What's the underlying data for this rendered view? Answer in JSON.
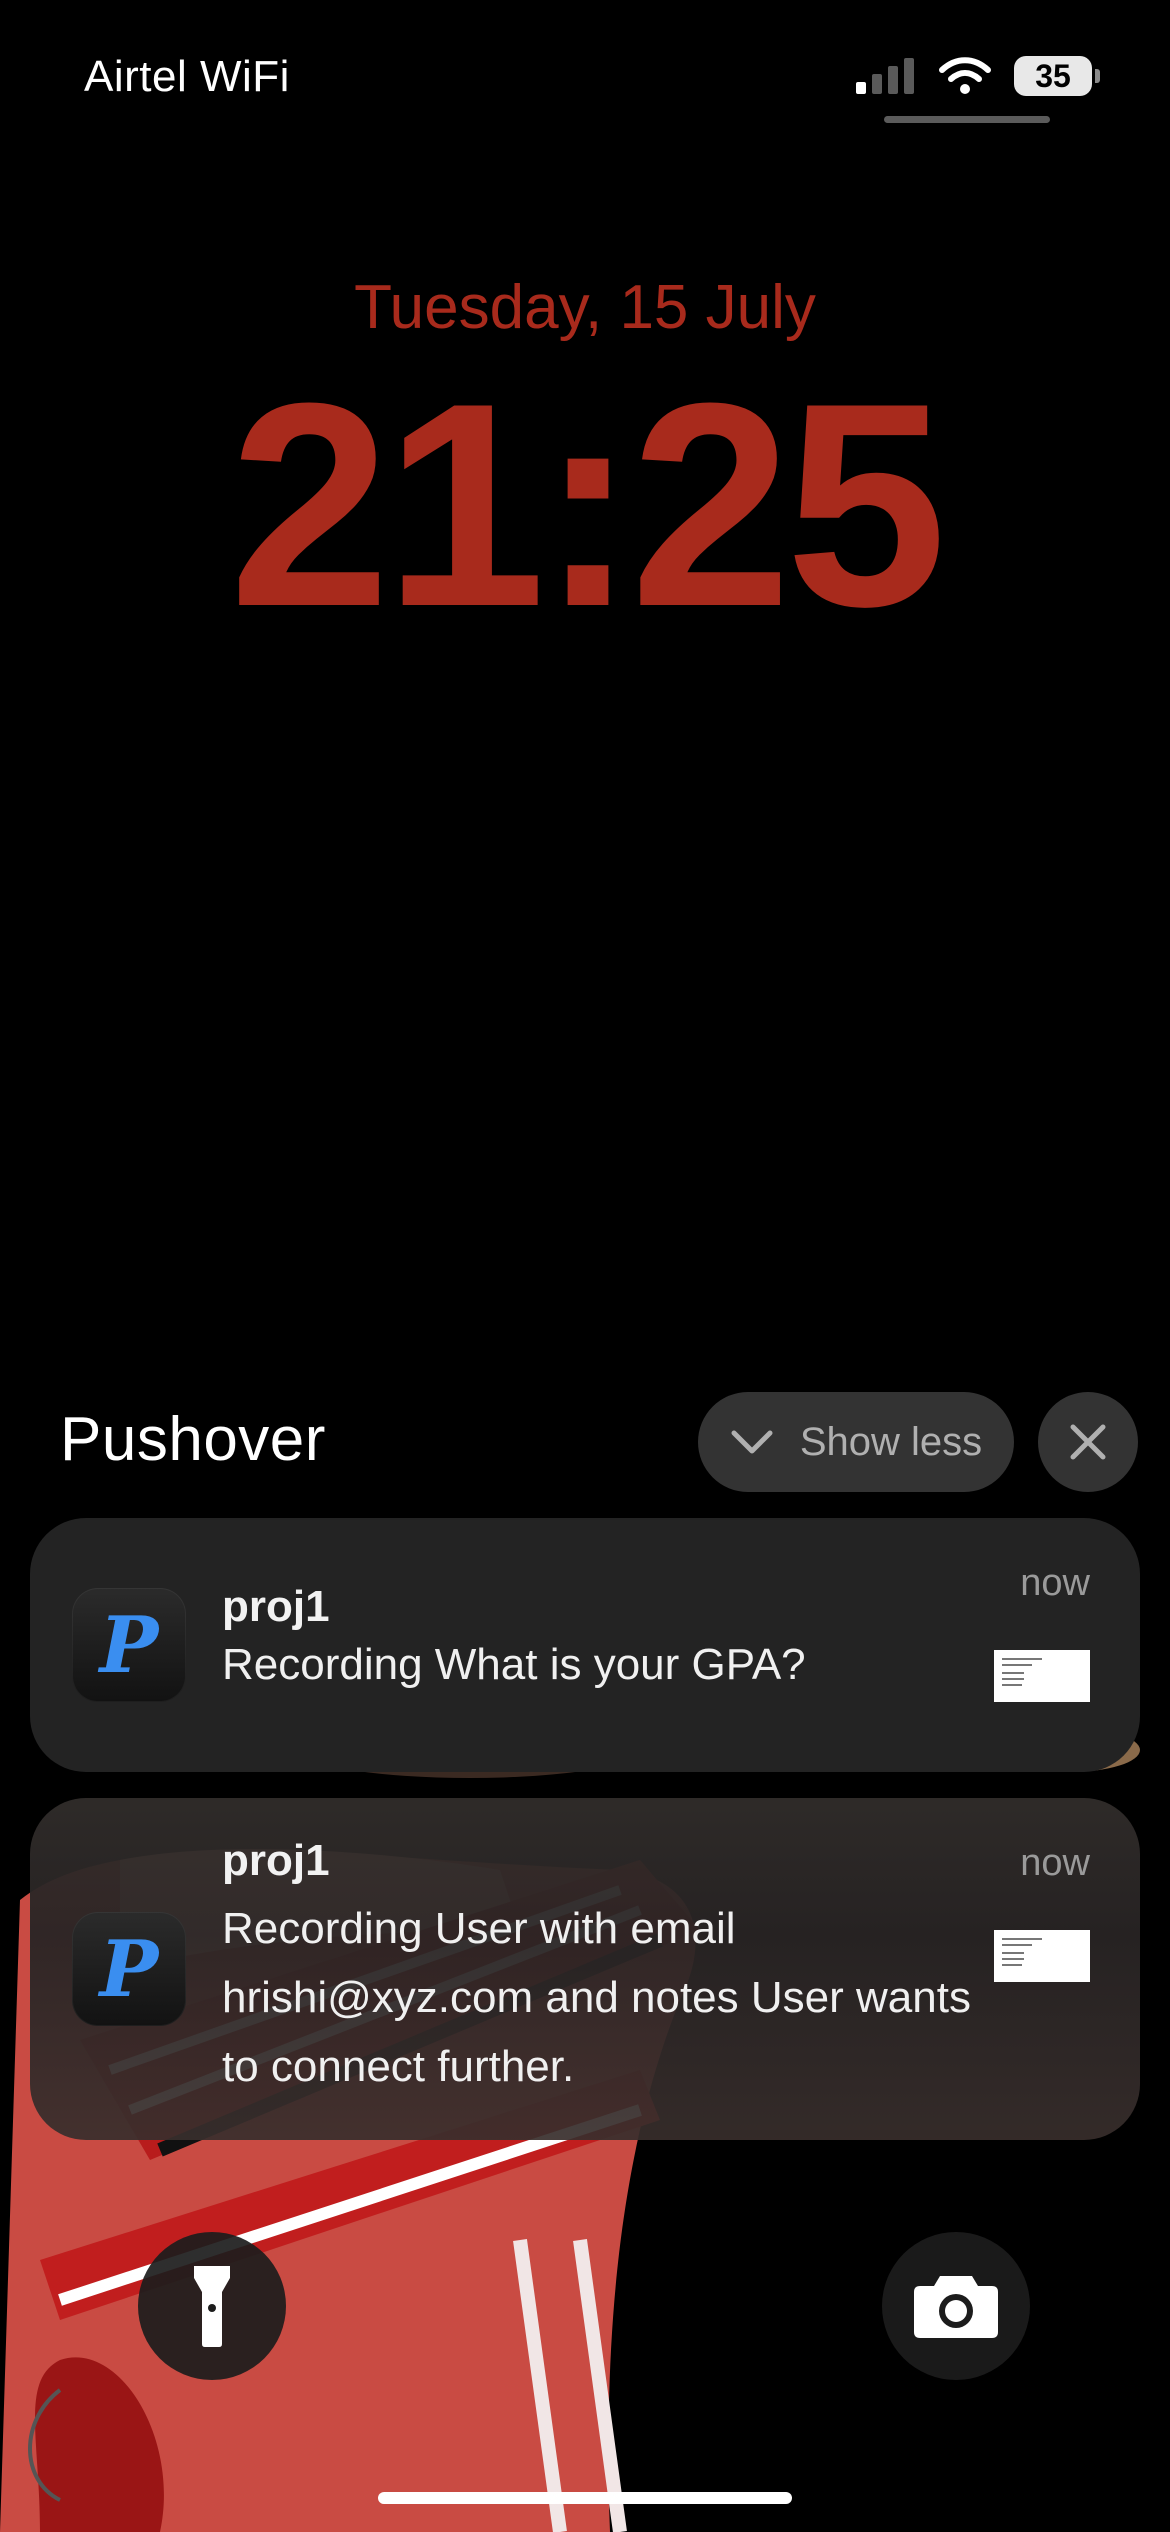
{
  "status_bar": {
    "carrier": "Airtel WiFi",
    "battery_level": "35",
    "signal_icon": "cellular-signal-icon",
    "wifi_icon": "wifi-icon"
  },
  "lock_screen": {
    "date": "Tuesday, 15 July",
    "time": "21:25",
    "accent_color": "#a82a1c"
  },
  "notification_group": {
    "app_name": "Pushover",
    "show_less_label": "Show less",
    "close_icon": "close-icon",
    "notifications": [
      {
        "title": "proj1",
        "body": "Recording What is your GPA?",
        "time": "now",
        "app_icon_letter": "P"
      },
      {
        "title": "proj1",
        "body": "Recording User with email hrishi@xyz.com and notes User wants to connect further.",
        "time": "now",
        "app_icon_letter": "P"
      }
    ]
  },
  "controls": {
    "flashlight_icon": "flashlight-icon",
    "camera_icon": "camera-icon"
  }
}
